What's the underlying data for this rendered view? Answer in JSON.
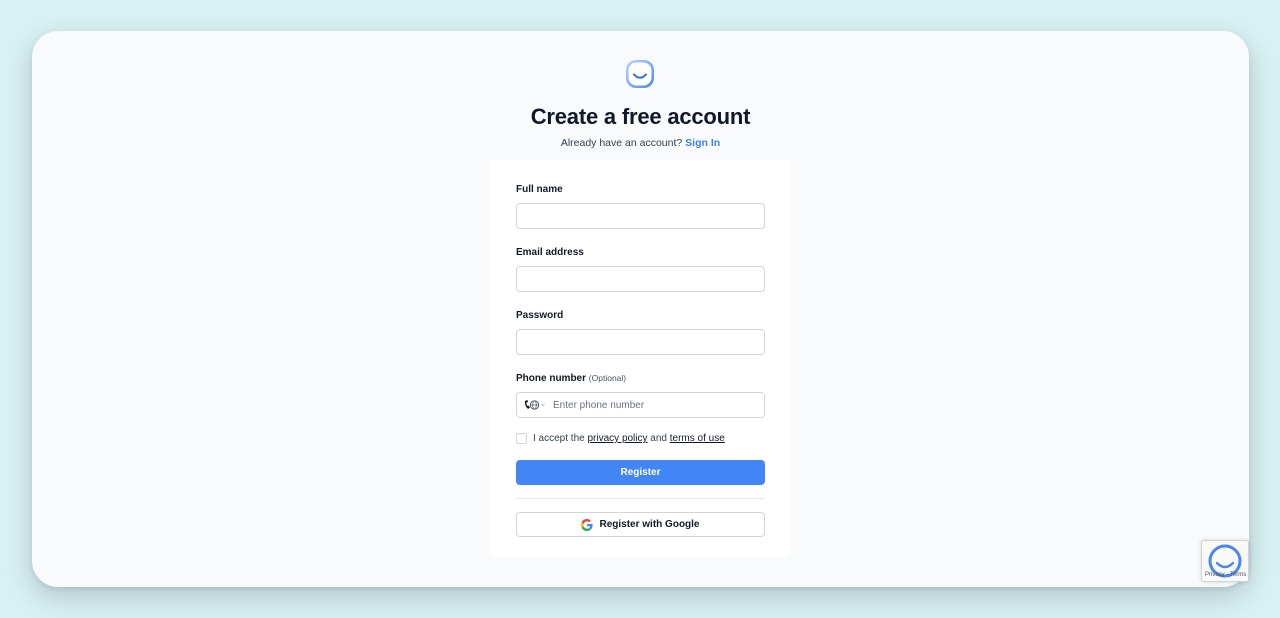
{
  "header": {
    "title": "Create a free account",
    "subtitle_prefix": "Already have an account?",
    "sign_in_label": "Sign In"
  },
  "form": {
    "full_name": {
      "label": "Full name",
      "value": "",
      "placeholder": ""
    },
    "email": {
      "label": "Email address",
      "value": "",
      "placeholder": ""
    },
    "password": {
      "label": "Password",
      "value": "",
      "placeholder": ""
    },
    "phone": {
      "label": "Phone number",
      "optional_label": "(Optional)",
      "value": "",
      "placeholder": "Enter phone number",
      "country_icon": "globe-phone-icon"
    },
    "terms": {
      "checked": false,
      "prefix": "I accept the",
      "privacy_label": "privacy policy",
      "and": "and",
      "terms_label": "terms of use"
    },
    "register_label": "Register",
    "google_label": "Register with Google"
  },
  "recaptcha": {
    "text": "Privacy - Terms"
  },
  "colors": {
    "primary": "#4285f4",
    "link": "#3b82f6",
    "page_bg": "#d8f1f3",
    "window_bg": "#f8fafc"
  }
}
